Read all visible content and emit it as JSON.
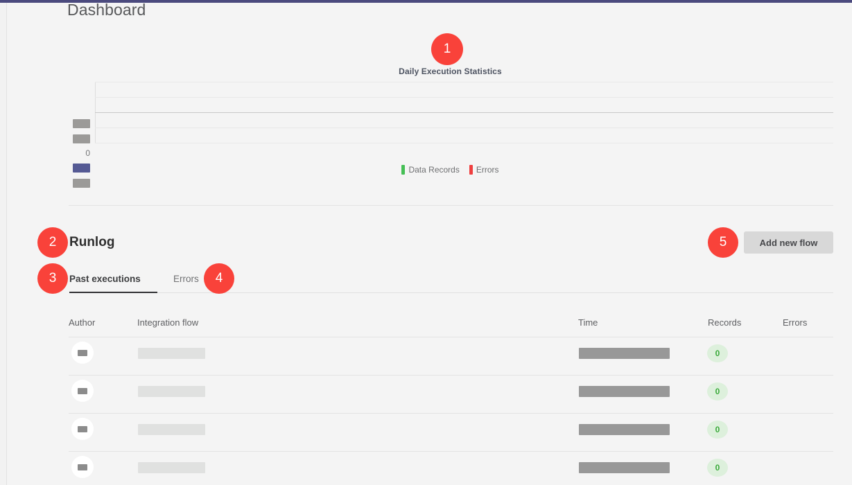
{
  "page": {
    "title": "Dashboard",
    "accent_color": "#4b4a7e",
    "background": "#f4f4f4",
    "marker_color": "#f9423a"
  },
  "chart_data": {
    "type": "bar",
    "title": "Daily Execution Statistics",
    "xlabel": "",
    "ylabel": "",
    "categories": [],
    "series": [
      {
        "name": "Data Records",
        "color": "#45bf55",
        "values": []
      },
      {
        "name": "Errors",
        "color": "#ef3f3f",
        "values": []
      }
    ],
    "y_tick_labels": [
      "",
      "",
      "0",
      "",
      ""
    ],
    "y_ticks_redacted": [
      true,
      true,
      false,
      true,
      true
    ],
    "y_tick_highlight_index": 3,
    "grid": true,
    "legend_position": "bottom",
    "note": "No bars plotted - all values are zero; y tick labels other than 0 are redacted"
  },
  "legend": {
    "items": [
      {
        "label": "Data Records",
        "color": "#45bf55"
      },
      {
        "label": "Errors",
        "color": "#ef3f3f"
      }
    ]
  },
  "runlog": {
    "heading": "Runlog",
    "add_button_label": "Add new flow",
    "tabs": [
      {
        "label": "Past executions",
        "active": true
      },
      {
        "label": "Errors",
        "active": false
      }
    ],
    "table": {
      "columns": [
        "Author",
        "Integration flow",
        "Time",
        "Records",
        "Errors"
      ],
      "rows": [
        {
          "author": "",
          "flow": "",
          "time": "",
          "records": "0",
          "errors": ""
        },
        {
          "author": "",
          "flow": "",
          "time": "",
          "records": "0",
          "errors": ""
        },
        {
          "author": "",
          "flow": "",
          "time": "",
          "records": "0",
          "errors": ""
        },
        {
          "author": "",
          "flow": "",
          "time": "",
          "records": "0",
          "errors": ""
        }
      ]
    }
  },
  "markers": [
    {
      "id": "1",
      "target": "daily-execution-statistics-chart"
    },
    {
      "id": "2",
      "target": "runlog-heading"
    },
    {
      "id": "3",
      "target": "tab-past-executions"
    },
    {
      "id": "4",
      "target": "tab-errors"
    },
    {
      "id": "5",
      "target": "add-new-flow-button"
    }
  ]
}
